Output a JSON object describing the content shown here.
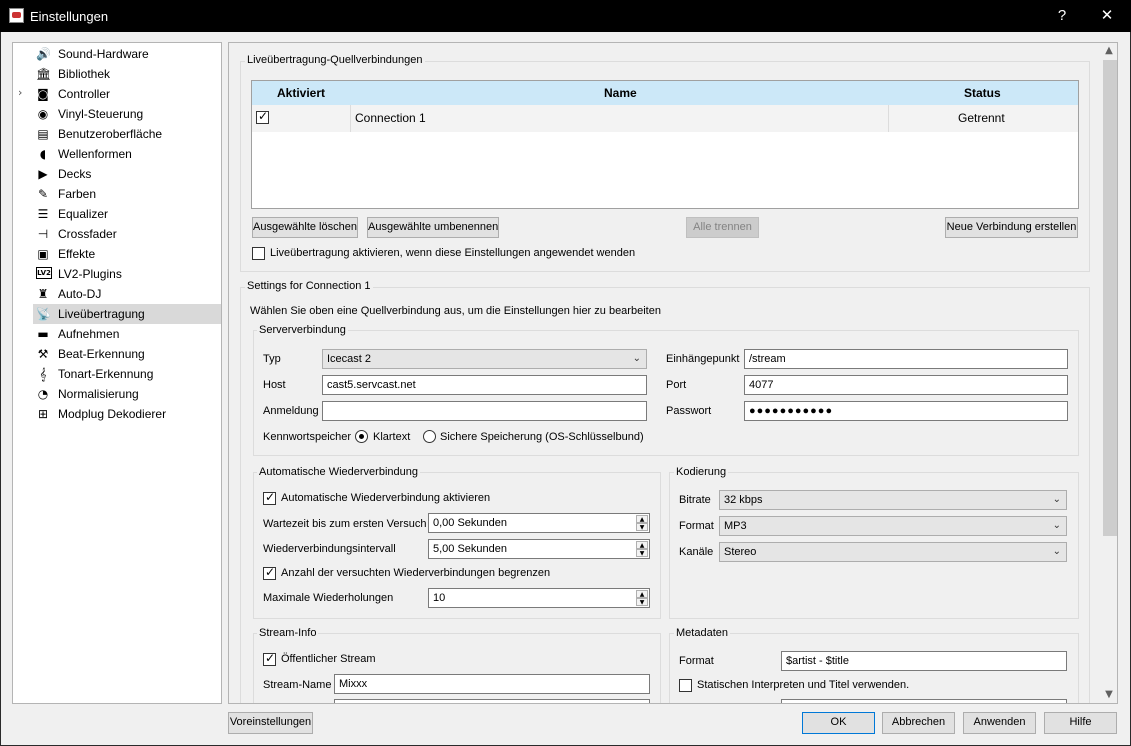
{
  "window": {
    "title": "Einstellungen",
    "help_label": "?",
    "close_label": "✕"
  },
  "sidebar": {
    "items": [
      {
        "label": "Sound-Hardware",
        "icon": "🔊"
      },
      {
        "label": "Bibliothek",
        "icon": "🏛"
      },
      {
        "label": "Controller",
        "icon": "◙"
      },
      {
        "label": "Vinyl-Steuerung",
        "icon": "◉"
      },
      {
        "label": "Benutzeroberfläche",
        "icon": "▤"
      },
      {
        "label": "Wellenformen",
        "icon": "◖"
      },
      {
        "label": "Decks",
        "icon": "▶"
      },
      {
        "label": "Farben",
        "icon": "✎"
      },
      {
        "label": "Equalizer",
        "icon": "☰"
      },
      {
        "label": "Crossfader",
        "icon": "⊣"
      },
      {
        "label": "Effekte",
        "icon": "▣"
      },
      {
        "label": "LV2-Plugins",
        "icon": "LV2"
      },
      {
        "label": "Auto-DJ",
        "icon": "♜"
      },
      {
        "label": "Liveübertragung",
        "icon": "📡"
      },
      {
        "label": "Aufnehmen",
        "icon": "▬"
      },
      {
        "label": "Beat-Erkennung",
        "icon": "⚒"
      },
      {
        "label": "Tonart-Erkennung",
        "icon": "𝄞"
      },
      {
        "label": "Normalisierung",
        "icon": "◔"
      },
      {
        "label": "Modplug Dekodierer",
        "icon": "⊞"
      }
    ],
    "expander": "›"
  },
  "sources": {
    "title": "Liveübertragung-Quellverbindungen",
    "columns": {
      "activated": "Aktiviert",
      "name": "Name",
      "status": "Status"
    },
    "rows": [
      {
        "name": "Connection 1",
        "status": "Getrennt"
      }
    ],
    "delete_label": "Ausgewählte löschen",
    "rename_label": "Ausgewählte umbenennen",
    "disconnect_all_label": "Alle trennen",
    "new_label": "Neue Verbindung erstellen",
    "auto_enable_label": "Liveübertragung aktivieren, wenn diese Einstellungen angewendet wenden"
  },
  "settings": {
    "title": "Settings for Connection 1",
    "hint": "Wählen Sie oben eine Quellverbindung aus, um die Einstellungen hier zu bearbeiten",
    "server": {
      "title": "Serververbindung",
      "type_label": "Typ",
      "type_value": "Icecast 2",
      "host_label": "Host",
      "host_value": "cast5.servcast.net",
      "login_label": "Anmeldung",
      "login_value": "",
      "mount_label": "Einhängepunkt",
      "mount_value": "/stream",
      "port_label": "Port",
      "port_value": "4077",
      "password_label": "Passwort",
      "password_value": "●●●●●●●●●●●",
      "pwstore_label": "Kennwortspeicher",
      "plain_label": "Klartext",
      "secure_label": "Sichere Speicherung (OS-Schlüsselbund)"
    },
    "reconnect": {
      "title": "Automatische Wiederverbindung",
      "enable_label": "Automatische Wiederverbindung aktivieren",
      "first_wait_label": "Wartezeit bis zum ersten Versuch",
      "first_wait_value": "0,00 Sekunden",
      "interval_label": "Wiederverbindungsintervall",
      "interval_value": "5,00 Sekunden",
      "limit_label": "Anzahl der versuchten Wiederverbindungen begrenzen",
      "max_label": "Maximale Wiederholungen",
      "max_value": "10"
    },
    "encoding": {
      "title": "Kodierung",
      "bitrate_label": "Bitrate",
      "bitrate_value": "32 kbps",
      "format_label": "Format",
      "format_value": "MP3",
      "channels_label": "Kanäle",
      "channels_value": "Stereo"
    },
    "streaminfo": {
      "title": "Stream-Info",
      "public_label": "Öffentlicher Stream",
      "name_label": "Stream-Name",
      "name_value": "Mixxx"
    },
    "metadata": {
      "title": "Metadaten",
      "format_label": "Format",
      "format_value": "$artist - $title",
      "static_label": "Statischen Interpreten und Titel verwenden."
    }
  },
  "footer": {
    "defaults_label": "Voreinstellungen",
    "ok_label": "OK",
    "cancel_label": "Abbrechen",
    "apply_label": "Anwenden",
    "help_label": "Hilfe"
  },
  "scrollbar": {
    "up": "▲",
    "down": "▼"
  },
  "combo_arrow": "⌄"
}
